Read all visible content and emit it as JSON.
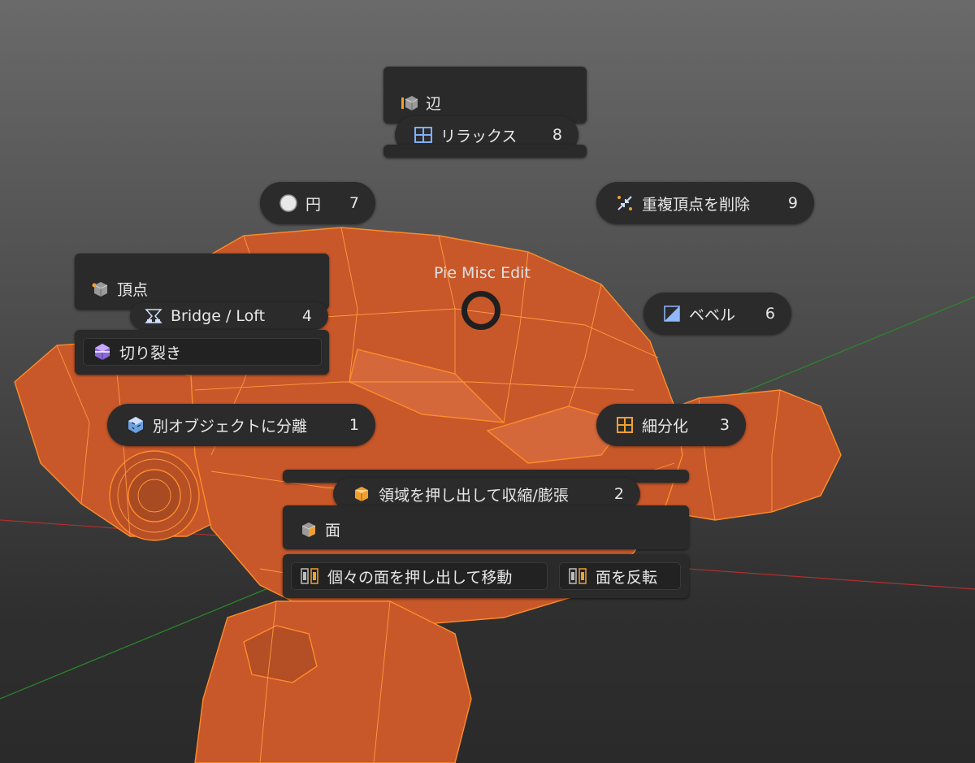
{
  "colors": {
    "mesh_fill": "#c8582a",
    "mesh_wire": "#ff8c2a",
    "panel_bg": "#2b2b2b",
    "axis_red": "#b03030",
    "axis_green": "#2a8a2a"
  },
  "pie": {
    "title": "Pie Misc Edit",
    "items": {
      "circle": {
        "label": "円",
        "num": "7",
        "icon": "circle-icon"
      },
      "merge": {
        "label": "重複頂点を削除",
        "num": "9",
        "icon": "merge-icon"
      },
      "bridge": {
        "label": "Bridge / Loft",
        "num": "4",
        "icon": "bridge-icon"
      },
      "bevel": {
        "label": "ベベル",
        "num": "6",
        "icon": "bevel-icon"
      },
      "separate": {
        "label": "別オブジェクトに分離",
        "num": "1",
        "icon": "separate-icon"
      },
      "subdivide": {
        "label": "細分化",
        "num": "3",
        "icon": "subdivide-icon"
      },
      "relax": {
        "label": "リラックス",
        "num": "8",
        "icon": "relax-icon"
      },
      "extrude": {
        "label": "領域を押し出して収縮/膨張",
        "num": "2",
        "icon": "extrude-icon"
      }
    },
    "edge_panel": {
      "label": "辺",
      "icon": "edge-cube-icon"
    },
    "vertex_panel": {
      "label": "頂点",
      "icon": "vertex-cube-icon"
    },
    "rip": {
      "label": "切り裂き",
      "icon": "rip-icon"
    },
    "face_panel": {
      "label": "面",
      "icon": "face-cube-icon"
    },
    "extrude_individual": {
      "label": "個々の面を押し出して移動",
      "icon": "extrude-individual-icon"
    },
    "flip": {
      "label": "面を反転",
      "icon": "flip-icon"
    }
  }
}
